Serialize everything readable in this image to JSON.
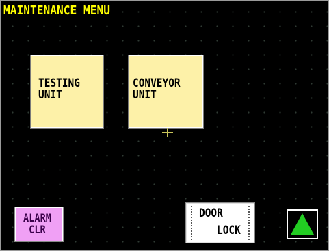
{
  "screen": {
    "title": "MAINTENANCE MENU"
  },
  "menu": {
    "testing_unit": {
      "line1": "TESTING",
      "line2": "UNIT"
    },
    "conveyor_unit": {
      "line1": "CONVEYOR",
      "line2": "UNIT"
    }
  },
  "footer": {
    "alarm_clear": {
      "line1": "ALARM",
      "line2": "CLR"
    },
    "door_lock": {
      "line1": "DOOR",
      "line2": "LOCK"
    },
    "up_arrow_icon": "triangle-up-icon"
  },
  "colors": {
    "background": "#000000",
    "title": "#ffff00",
    "menu_tile": "#fdf1a8",
    "alarm_button": "#f0a0f5",
    "door_button": "#ffffff",
    "arrow": "#22cc22"
  }
}
